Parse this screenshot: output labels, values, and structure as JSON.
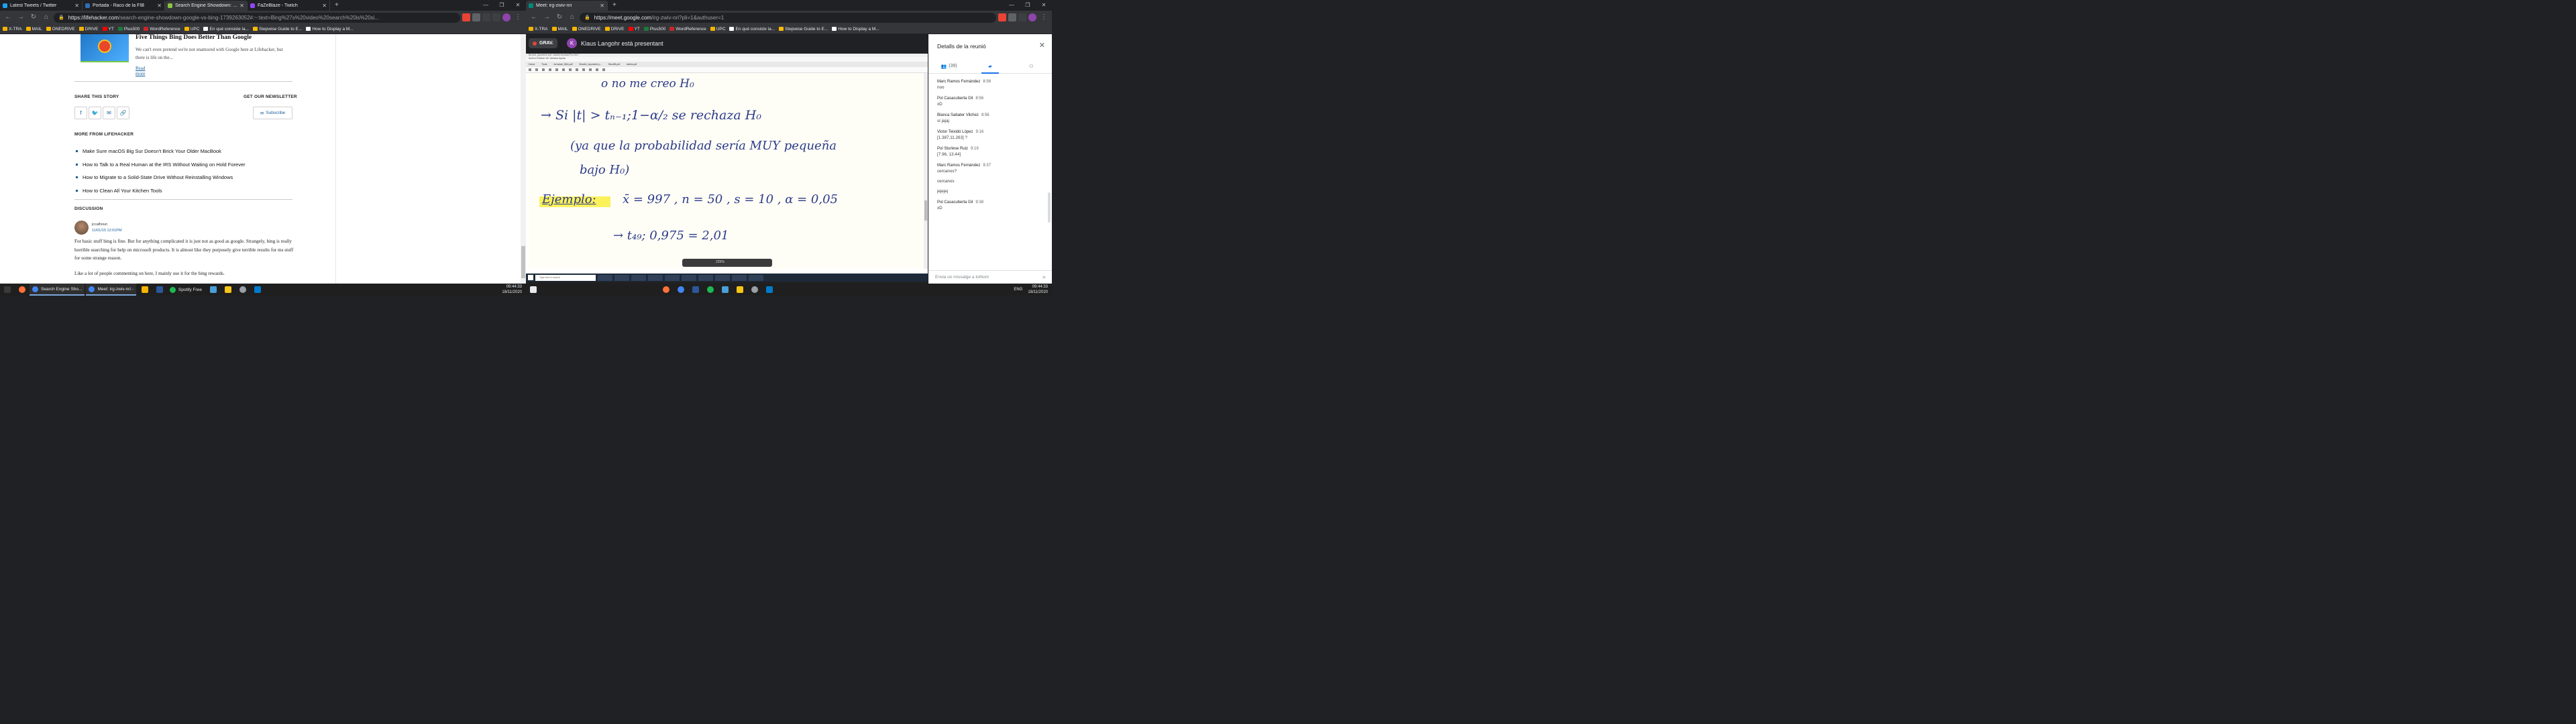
{
  "left": {
    "tabs": [
      {
        "label": "Latest Tweets / Twitter",
        "color": "#1da1f2"
      },
      {
        "label": "Portada - Raco de la FIB",
        "color": "#2d6fb6"
      },
      {
        "label": "Search Engine Showdown: Goog",
        "color": "#8cc63f"
      },
      {
        "label": "FaZeBlaze - Twitch",
        "color": "#9146ff"
      }
    ],
    "url_host": "https://lifehacker.com",
    "url_path": "/search-engine-showdown-google-vs-bing-1739263052#:~:text=Bing%27s%20video%20search%20is%20si...",
    "bookmarks": [
      "X-TRA",
      "MAIL",
      "ONEDRIVE",
      "DRIVE",
      "YT",
      "Plus500",
      "WordReference",
      "UPC",
      "En qué consiste la...",
      "Stepwise Guide to E...",
      "How to Display a M..."
    ],
    "page": {
      "card_title": "Five Things Bing Does Better Than Google",
      "card_desc": "We can't even pretend we're not enamored with Google here at Lifehacker, but there is life on the...",
      "read_more": "Read more",
      "share_heading": "SHARE THIS STORY",
      "newsletter_heading": "GET OUR NEWSLETTER",
      "subscribe": "Subscribe",
      "more_heading": "MORE FROM LIFEHACKER",
      "more_links": [
        "Make Sure macOS Big Sur Doesn't Brick Your Older MacBook",
        "How to Talk to a Real Human at the IRS Without Waiting on Hold Forever",
        "How to Migrate to a Solid-State Drive Without Reinstalling Windows",
        "How to Clean All Your Kitchen Tools"
      ],
      "discussion_heading": "DISCUSSION",
      "comment_user": "jccalhoun",
      "comment_date": "11/01/15 12:01PM",
      "comment_text": "For basic stuff bing is fine. But for anything complicated it is just not as good as google. Strangely, bing is really horrible searching for help on microsoft products. It is almost like they purposely give terrible results for ms stuff for some strange reason.",
      "comment_text2": "Like a lot of people commenting on here, I mainly use it for the bing rewards."
    },
    "taskbar": {
      "items": [
        "Search Engine Sho...",
        "Meet: irg-zwiv-nri -",
        "Spotify Free"
      ],
      "time": "09:44:33",
      "date": "18/11/2020"
    }
  },
  "right": {
    "tabs": [
      {
        "label": "Meet: irg-zwiv-nri",
        "color": "#00897b"
      }
    ],
    "url_host": "https://meet.google.com",
    "url_path": "/irg-zwiv-nri?pli=1&authuser=1",
    "bookmarks": [
      "X-TRA",
      "MAIL",
      "ONEDRIVE",
      "DRIVE",
      "YT",
      "Plus500",
      "WordReference",
      "UPC",
      "En qué consiste la...",
      "Stepwise Guide to E...",
      "How to Display a M..."
    ],
    "meet": {
      "rec": "GRAV.",
      "presenter_initial": "K",
      "presenter_text": "Klaus Langohr està presentant",
      "side_title": "Detalls de la reunió",
      "people_count": "(39)",
      "compose_placeholder": "Envia un missatge a tothom",
      "messages": [
        {
          "who": "Marc Ramos Fernández",
          "time": "8:56",
          "lines": [
            "noo"
          ]
        },
        {
          "who": "Pol Casacuberta Gil",
          "time": "8:56",
          "lines": [
            "xD"
          ]
        },
        {
          "who": "Blanca Sabater Vilchez",
          "time": "8:56",
          "lines": [
            "sí jajaj"
          ]
        },
        {
          "who": "Victor Teixidó López",
          "time": "9:16",
          "lines": [
            "[1.387,11.263] ?"
          ]
        },
        {
          "who": "Pol Sturlese Ruiz",
          "time": "9:19",
          "lines": [
            "[7.96, 13.44]"
          ]
        },
        {
          "who": "Marc Ramos Fernández",
          "time": "9:37",
          "lines": [
            "cercanos?",
            "cercanos",
            "jejejej"
          ]
        },
        {
          "who": "Pol Casacuberta Gil",
          "time": "9:38",
          "lines": [
            "xD"
          ]
        }
      ],
      "acrobat": {
        "title": "Bloc6A_Apuntes2.pdf - Adobe Acrobat Pro 2017",
        "menu": "Archivo  Edición  Ver  Ventana  Ayuda",
        "tabs": [
          "Home",
          "Tools",
          "formulari_B6A.pdf",
          "Bloc6A_Apuntes2.p...",
          "Bloc6B.pdf",
          "tables.pdf"
        ],
        "zoom": "225%",
        "search": "Type here to search",
        "handwriting": [
          "o no me creo H₀",
          "→ Si |t| > tₙ₋₁;1−α/₂  se rechaza H₀",
          "(ya que la probabilidad sería MUY pequeña",
          "bajo H₀)",
          "Ejemplo:",
          "x̄ = 997 ,  n = 50 ,  s = 10 ,  α = 0,05",
          "→ t₄₉; 0,975 = 2,01"
        ]
      }
    },
    "taskbar": {
      "time": "09:44:33",
      "date": "18/11/2020",
      "lang": "ENG"
    }
  }
}
